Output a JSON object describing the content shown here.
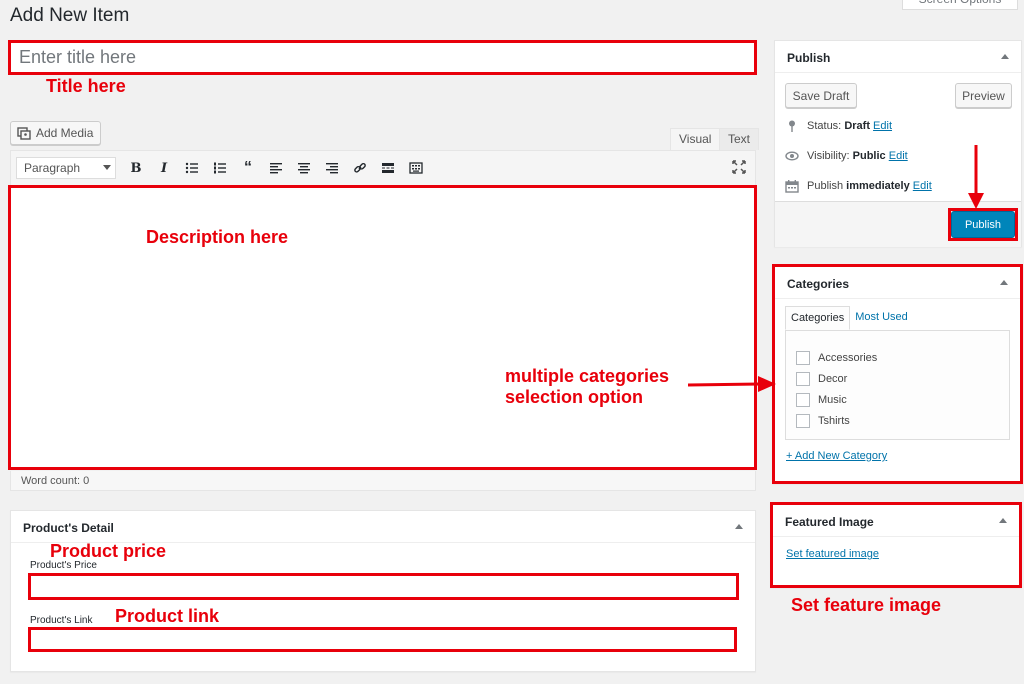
{
  "header": {
    "page_title": "Add New Item",
    "screen_options": "Screen Options"
  },
  "title_field": {
    "placeholder": "Enter title here",
    "value": ""
  },
  "editor": {
    "add_media": "Add Media",
    "tabs": [
      "Visual",
      "Text"
    ],
    "format_select": "Paragraph",
    "word_count": "Word count: 0"
  },
  "product_detail": {
    "heading": "Product's Detail",
    "price_label": "Product's Price",
    "link_label": "Product's Link"
  },
  "publish": {
    "heading": "Publish",
    "save_draft": "Save Draft",
    "preview": "Preview",
    "status_label": "Status:",
    "status_value": "Draft",
    "visibility_label": "Visibility:",
    "visibility_value": "Public",
    "schedule_label": "Publish",
    "schedule_value": "immediately",
    "edit": "Edit",
    "publish_button": "Publish"
  },
  "categories": {
    "heading": "Categories",
    "tabs": [
      "Categories",
      "Most Used"
    ],
    "items": [
      "Accessories",
      "Decor",
      "Music",
      "Tshirts"
    ],
    "add_new": "+ Add New Category"
  },
  "featured_image": {
    "heading": "Featured Image",
    "link": "Set featured image"
  },
  "annotations": {
    "title": "Title here",
    "description": "Description here",
    "categories_line1": "multiple categories",
    "categories_line2": "selection option",
    "price": "Product price",
    "link": "Product link",
    "featured": "Set feature image"
  },
  "colors": {
    "annotation_red": "#e8000b",
    "primary_blue": "#0085ba",
    "link_blue": "#0073aa"
  }
}
